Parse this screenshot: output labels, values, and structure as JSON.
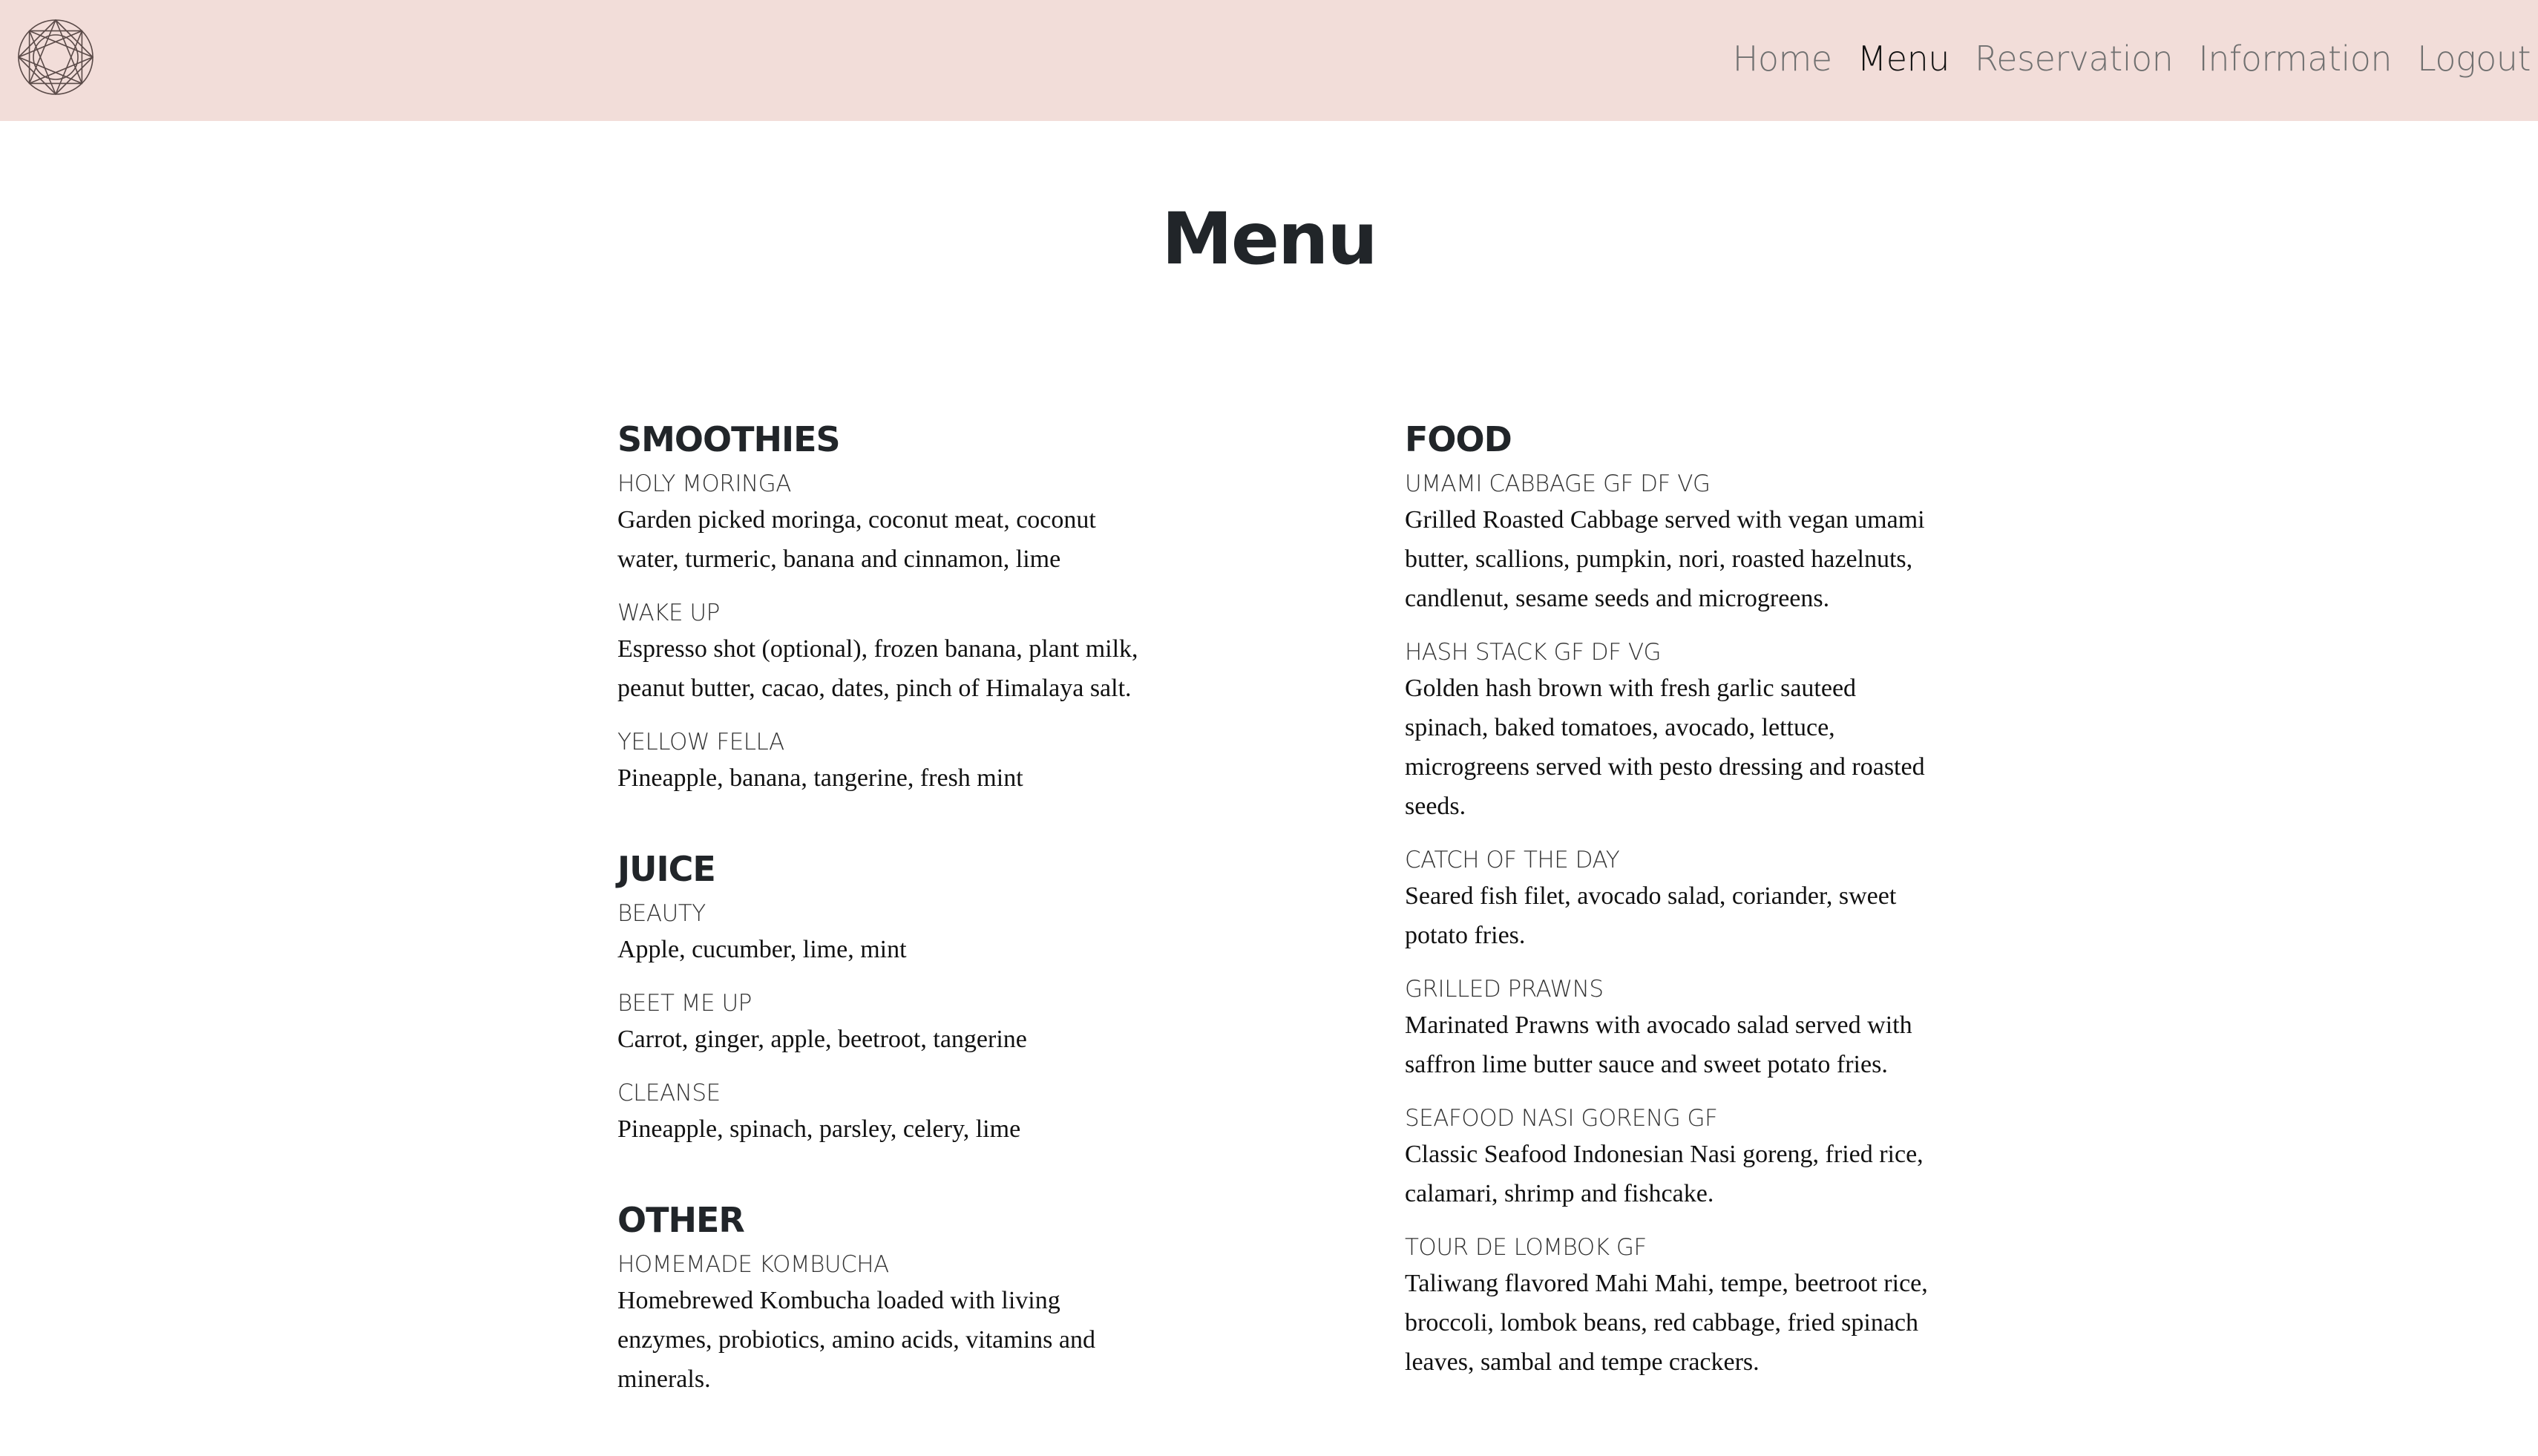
{
  "nav": {
    "logo_icon": "geometric-gem-logo-icon",
    "links": [
      "Home",
      "Menu",
      "Reservation",
      "Information",
      "Logout"
    ],
    "active": "Menu"
  },
  "page": {
    "title": "Menu"
  },
  "columns": {
    "left": [
      {
        "heading": "SMOOTHIES",
        "items": [
          {
            "name": "HOLY MORINGA",
            "description": "Garden picked moringa, coconut meat, coconut water, turmeric, banana and cinnamon, lime"
          },
          {
            "name": "WAKE UP",
            "description": "Espresso shot (optional), frozen banana, plant milk, peanut butter, cacao, dates, pinch of Himalaya salt."
          },
          {
            "name": "YELLOW FELLA",
            "description": "Pineapple, banana, tangerine, fresh mint"
          }
        ]
      },
      {
        "heading": "JUICE",
        "items": [
          {
            "name": "BEAUTY",
            "description": "Apple, cucumber, lime, mint"
          },
          {
            "name": "BEET ME UP",
            "description": "Carrot, ginger, apple, beetroot, tangerine"
          },
          {
            "name": "CLEANSE",
            "description": "Pineapple, spinach, parsley, celery, lime"
          }
        ]
      },
      {
        "heading": "OTHER",
        "items": [
          {
            "name": "HOMEMADE KOMBUCHA",
            "description": "Homebrewed Kombucha loaded with living enzymes, probiotics, amino acids, vitamins and minerals."
          }
        ]
      }
    ],
    "right": [
      {
        "heading": "FOOD",
        "items": [
          {
            "name": "UMAMI CABBAGE GF DF VG",
            "description": "Grilled Roasted Cabbage served with vegan umami butter, scallions, pumpkin, nori, roasted hazelnuts, candlenut, sesame seeds and microgreens."
          },
          {
            "name": "HASH STACK GF DF VG",
            "description": "Golden hash brown with fresh garlic sauteed spinach, baked tomatoes, avocado, lettuce, microgreens served with pesto dressing and roasted seeds."
          },
          {
            "name": "CATCH OF THE DAY",
            "description": "Seared fish filet, avocado salad, coriander, sweet potato fries."
          },
          {
            "name": "GRILLED PRAWNS",
            "description": "Marinated Prawns with avocado salad served with saffron lime butter sauce and sweet potato fries."
          },
          {
            "name": "SEAFOOD NASI GORENG GF",
            "description": "Classic Seafood Indonesian Nasi goreng, fried rice, calamari, shrimp and fishcake."
          },
          {
            "name": "TOUR DE LOMBOK GF",
            "description": "Taliwang flavored Mahi Mahi, tempe, beetroot rice, broccoli, lombok beans, red cabbage, fried spinach leaves, sambal and tempe crackers."
          }
        ]
      }
    ]
  }
}
